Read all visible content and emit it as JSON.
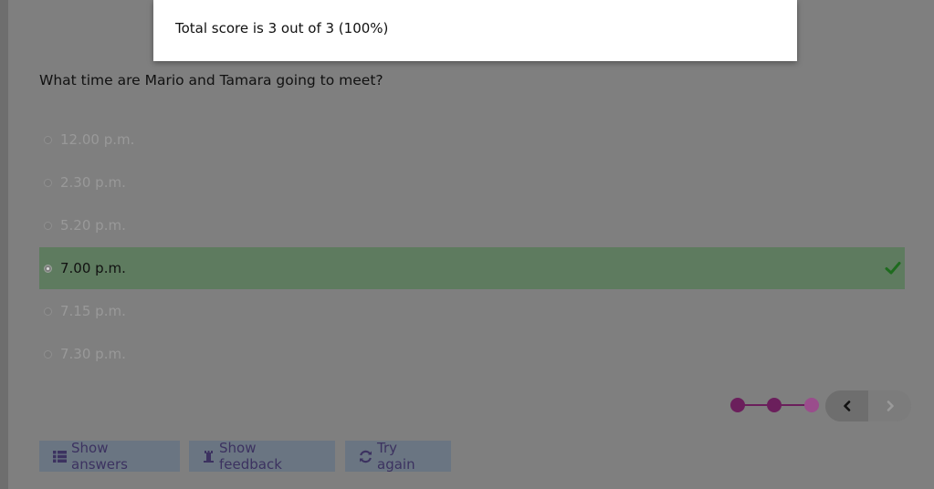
{
  "popup": {
    "score_text": "Total score is 3 out of 3 (100%)"
  },
  "question": {
    "text": "What time are Mario and Tamara going to meet?",
    "options": [
      {
        "label": "12.00 p.m.",
        "selected": false,
        "correct": false
      },
      {
        "label": "2.30 p.m.",
        "selected": false,
        "correct": false
      },
      {
        "label": "5.20 p.m.",
        "selected": false,
        "correct": false
      },
      {
        "label": "7.00 p.m.",
        "selected": true,
        "correct": true
      },
      {
        "label": "7.15 p.m.",
        "selected": false,
        "correct": false
      },
      {
        "label": "7.30 p.m.",
        "selected": false,
        "correct": false
      }
    ]
  },
  "progress": {
    "total_steps": 3,
    "current_step": 3
  },
  "navigation": {
    "prev_icon": "chevron-left-icon",
    "next_icon": "chevron-right-icon"
  },
  "buttons": {
    "show_answers": "Show answers",
    "show_feedback": "Show feedback",
    "try_again": "Try again"
  },
  "colors": {
    "correct_bg": "#5e7b5f",
    "check": "#1e6b1e",
    "progress_dot": "#6b1f5c",
    "progress_dot_current": "#9a4d8c",
    "button_text": "#3c3260"
  }
}
